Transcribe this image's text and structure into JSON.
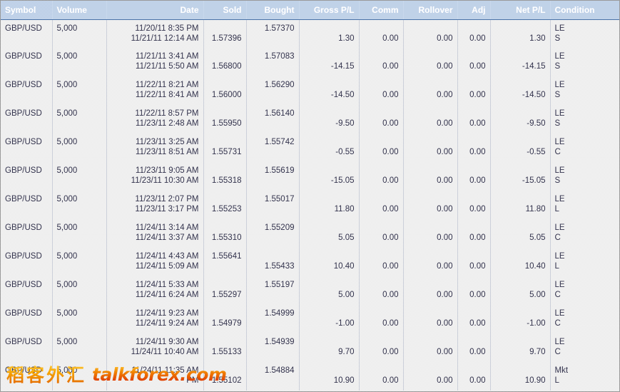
{
  "table": {
    "columns": [
      {
        "key": "symbol",
        "label": "Symbol",
        "align": "left"
      },
      {
        "key": "volume",
        "label": "Volume",
        "align": "left"
      },
      {
        "key": "date",
        "label": "Date",
        "align": "right"
      },
      {
        "key": "sold",
        "label": "Sold",
        "align": "right"
      },
      {
        "key": "bought",
        "label": "Bought",
        "align": "right"
      },
      {
        "key": "gross_pl",
        "label": "Gross P/L",
        "align": "right"
      },
      {
        "key": "comm",
        "label": "Comm",
        "align": "right"
      },
      {
        "key": "rollover",
        "label": "Rollover",
        "align": "right"
      },
      {
        "key": "adj",
        "label": "Adj",
        "align": "right"
      },
      {
        "key": "net_pl",
        "label": "Net P/L",
        "align": "right"
      },
      {
        "key": "condition",
        "label": "Condition",
        "align": "left"
      }
    ],
    "rows": [
      {
        "symbol": "GBP/USD",
        "volume": "5,000",
        "date_open": "11/20/11 8:35 PM",
        "date_close": "11/21/11 12:14 AM",
        "sold_open": "",
        "sold_close": "1.57396",
        "bought_open": "1.57370",
        "bought_close": "",
        "gross_pl": "1.30",
        "comm": "0.00",
        "rollover": "0.00",
        "adj": "0.00",
        "net_pl": "1.30",
        "condition_top": "LE",
        "condition_bottom": "S"
      },
      {
        "symbol": "GBP/USD",
        "volume": "5,000",
        "date_open": "11/21/11 3:41 AM",
        "date_close": "11/21/11 5:50 AM",
        "sold_open": "",
        "sold_close": "1.56800",
        "bought_open": "1.57083",
        "bought_close": "",
        "gross_pl": "-14.15",
        "comm": "0.00",
        "rollover": "0.00",
        "adj": "0.00",
        "net_pl": "-14.15",
        "condition_top": "LE",
        "condition_bottom": "S"
      },
      {
        "symbol": "GBP/USD",
        "volume": "5,000",
        "date_open": "11/22/11 8:21 AM",
        "date_close": "11/22/11 8:41 AM",
        "sold_open": "",
        "sold_close": "1.56000",
        "bought_open": "1.56290",
        "bought_close": "",
        "gross_pl": "-14.50",
        "comm": "0.00",
        "rollover": "0.00",
        "adj": "0.00",
        "net_pl": "-14.50",
        "condition_top": "LE",
        "condition_bottom": "S"
      },
      {
        "symbol": "GBP/USD",
        "volume": "5,000",
        "date_open": "11/22/11 8:57 PM",
        "date_close": "11/23/11 2:48 AM",
        "sold_open": "",
        "sold_close": "1.55950",
        "bought_open": "1.56140",
        "bought_close": "",
        "gross_pl": "-9.50",
        "comm": "0.00",
        "rollover": "0.00",
        "adj": "0.00",
        "net_pl": "-9.50",
        "condition_top": "LE",
        "condition_bottom": "S"
      },
      {
        "symbol": "GBP/USD",
        "volume": "5,000",
        "date_open": "11/23/11 3:25 AM",
        "date_close": "11/23/11 8:51 AM",
        "sold_open": "",
        "sold_close": "1.55731",
        "bought_open": "1.55742",
        "bought_close": "",
        "gross_pl": "-0.55",
        "comm": "0.00",
        "rollover": "0.00",
        "adj": "0.00",
        "net_pl": "-0.55",
        "condition_top": "LE",
        "condition_bottom": "C"
      },
      {
        "symbol": "GBP/USD",
        "volume": "5,000",
        "date_open": "11/23/11 9:05 AM",
        "date_close": "11/23/11 10:30 AM",
        "sold_open": "",
        "sold_close": "1.55318",
        "bought_open": "1.55619",
        "bought_close": "",
        "gross_pl": "-15.05",
        "comm": "0.00",
        "rollover": "0.00",
        "adj": "0.00",
        "net_pl": "-15.05",
        "condition_top": "LE",
        "condition_bottom": "S"
      },
      {
        "symbol": "GBP/USD",
        "volume": "5,000",
        "date_open": "11/23/11 2:07 PM",
        "date_close": "11/23/11 3:17 PM",
        "sold_open": "",
        "sold_close": "1.55253",
        "bought_open": "1.55017",
        "bought_close": "",
        "gross_pl": "11.80",
        "comm": "0.00",
        "rollover": "0.00",
        "adj": "0.00",
        "net_pl": "11.80",
        "condition_top": "LE",
        "condition_bottom": "L"
      },
      {
        "symbol": "GBP/USD",
        "volume": "5,000",
        "date_open": "11/24/11 3:14 AM",
        "date_close": "11/24/11 3:37 AM",
        "sold_open": "",
        "sold_close": "1.55310",
        "bought_open": "1.55209",
        "bought_close": "",
        "gross_pl": "5.05",
        "comm": "0.00",
        "rollover": "0.00",
        "adj": "0.00",
        "net_pl": "5.05",
        "condition_top": "LE",
        "condition_bottom": "C"
      },
      {
        "symbol": "GBP/USD",
        "volume": "5,000",
        "date_open": "11/24/11 4:43 AM",
        "date_close": "11/24/11 5:09 AM",
        "sold_open": "1.55641",
        "sold_close": "",
        "bought_open": "",
        "bought_close": "1.55433",
        "gross_pl": "10.40",
        "comm": "0.00",
        "rollover": "0.00",
        "adj": "0.00",
        "net_pl": "10.40",
        "condition_top": "LE",
        "condition_bottom": "L"
      },
      {
        "symbol": "GBP/USD",
        "volume": "5,000",
        "date_open": "11/24/11 5:33 AM",
        "date_close": "11/24/11 6:24 AM",
        "sold_open": "",
        "sold_close": "1.55297",
        "bought_open": "1.55197",
        "bought_close": "",
        "gross_pl": "5.00",
        "comm": "0.00",
        "rollover": "0.00",
        "adj": "0.00",
        "net_pl": "5.00",
        "condition_top": "LE",
        "condition_bottom": "C"
      },
      {
        "symbol": "GBP/USD",
        "volume": "5,000",
        "date_open": "11/24/11 9:23 AM",
        "date_close": "11/24/11 9:24 AM",
        "sold_open": "",
        "sold_close": "1.54979",
        "bought_open": "1.54999",
        "bought_close": "",
        "gross_pl": "-1.00",
        "comm": "0.00",
        "rollover": "0.00",
        "adj": "0.00",
        "net_pl": "-1.00",
        "condition_top": "LE",
        "condition_bottom": "C"
      },
      {
        "symbol": "GBP/USD",
        "volume": "5,000",
        "date_open": "11/24/11 9:30 AM",
        "date_close": "11/24/11 10:40 AM",
        "sold_open": "",
        "sold_close": "1.55133",
        "bought_open": "1.54939",
        "bought_close": "",
        "gross_pl": "9.70",
        "comm": "0.00",
        "rollover": "0.00",
        "adj": "0.00",
        "net_pl": "9.70",
        "condition_top": "LE",
        "condition_bottom": "C"
      },
      {
        "symbol": "GBP/USD",
        "volume": "5,000",
        "date_open": "11/24/11 11:35 AM",
        "date_close": "PM",
        "sold_open": "",
        "sold_close": "1.55102",
        "bought_open": "1.54884",
        "bought_close": "",
        "gross_pl": "10.90",
        "comm": "0.00",
        "rollover": "0.00",
        "adj": "0.00",
        "net_pl": "10.90",
        "condition_top": "Mkt",
        "condition_bottom": "L"
      }
    ]
  },
  "watermark": {
    "cjk_text": "稻客外汇",
    "latin_text": "talkforex.com"
  },
  "colors": {
    "header_bg": "#a8c0e0",
    "header_text": "#ffffff",
    "body_text": "#33334d",
    "grid_line": "#9aa6bd",
    "watermark_gold": "#f5a300",
    "watermark_red": "#d81f00"
  }
}
